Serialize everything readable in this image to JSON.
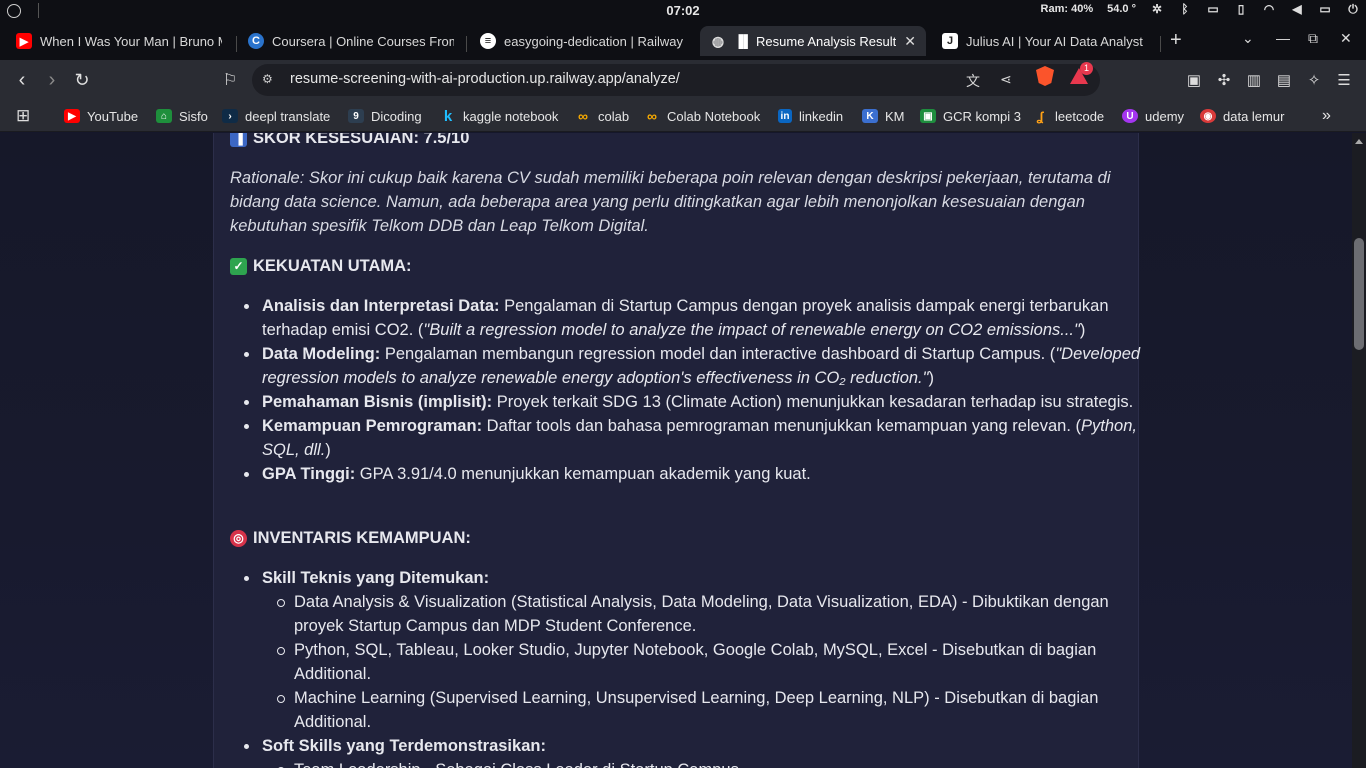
{
  "system": {
    "clock": "07:02",
    "ram": "Ram: 40%",
    "temp": "54.0 °"
  },
  "tabs": [
    {
      "title": "When I Was Your Man | Bruno M",
      "icon": "youtube-icon",
      "color": "#ff0000"
    },
    {
      "title": "Coursera | Online Courses From",
      "icon": "coursera-icon",
      "color": "#2a73cc"
    },
    {
      "title": "easygoing-dedication | Railway",
      "icon": "railway-icon",
      "color": "#ffffff"
    },
    {
      "title": "Resume Analysis Results",
      "icon": "globe-icon",
      "active": true
    },
    {
      "title": "Julius AI | Your AI Data Analyst",
      "icon": "julius-icon",
      "color": "#ffffff"
    }
  ],
  "address": {
    "url": "resume-screening-with-ai-production.up.railway.app/analyze/",
    "badge": "1"
  },
  "bookmarks": [
    {
      "label": "YouTube",
      "icon": "youtube-icon",
      "color": "#ff0000"
    },
    {
      "label": "Sisfo",
      "icon": "sisfo-icon",
      "color": "#1e8f3c"
    },
    {
      "label": "deepl translate",
      "icon": "deepl-icon",
      "color": "#0f2b46"
    },
    {
      "label": "Dicoding",
      "icon": "dicoding-icon",
      "color": "#2d3e50"
    },
    {
      "label": "kaggle notebook",
      "icon": "kaggle-icon",
      "color": "#20beff"
    },
    {
      "label": "colab",
      "icon": "colab-icon",
      "color": "#f9ab00"
    },
    {
      "label": "Colab Notebook",
      "icon": "colab-icon",
      "color": "#f9ab00"
    },
    {
      "label": "linkedin",
      "icon": "linkedin-icon",
      "color": "#0a66c2"
    },
    {
      "label": "KM",
      "icon": "km-icon",
      "color": "#3b6fd0"
    },
    {
      "label": "GCR kompi 3",
      "icon": "classroom-icon",
      "color": "#1e8e3e"
    },
    {
      "label": "leetcode",
      "icon": "leetcode-icon",
      "color": "#ffa116"
    },
    {
      "label": "udemy",
      "icon": "udemy-icon",
      "color": "#a435f0"
    },
    {
      "label": "data lemur",
      "icon": "datalemur-icon",
      "color": "#d93a3a"
    }
  ],
  "analysis": {
    "score_heading": "SKOR KESESUAIAN: 7.5/10",
    "rationale": "Rationale: Skor ini cukup baik karena CV sudah memiliki beberapa poin relevan dengan deskripsi pekerjaan, terutama di bidang data science. Namun, ada beberapa area yang perlu ditingkatkan agar lebih menonjolkan kesesuaian dengan kebutuhan spesifik Telkom DDB dan Leap Telkom Digital.",
    "strengths_heading": "KEKUATAN UTAMA:",
    "strengths": [
      {
        "title": "Analisis dan Interpretasi Data:",
        "text": " Pengalaman di Startup Campus dengan proyek analisis dampak energi terbarukan terhadap emisi CO2. (",
        "quote": "\"Built a regression model to analyze the impact of renewable energy on CO2 emissions...\"",
        "tail": ")"
      },
      {
        "title": "Data Modeling:",
        "text": " Pengalaman membangun regression model dan interactive dashboard di Startup Campus. (",
        "quote": "\"Developed regression models to analyze renewable energy adoption's effectiveness in CO₂ reduction.\"",
        "tail": ")"
      },
      {
        "title": "Pemahaman Bisnis (implisit):",
        "text": " Proyek terkait SDG 13 (Climate Action) menunjukkan kesadaran terhadap isu strategis.",
        "quote": "",
        "tail": ""
      },
      {
        "title": "Kemampuan Pemrograman:",
        "text": " Daftar tools dan bahasa pemrograman menunjukkan kemampuan yang relevan. (",
        "quote": "Python, SQL, dll.",
        "tail": ")"
      },
      {
        "title": "GPA Tinggi:",
        "text": " GPA 3.91/4.0 menunjukkan kemampuan akademik yang kuat.",
        "quote": "",
        "tail": ""
      }
    ],
    "inventory_heading": "INVENTARIS KEMAMPUAN:",
    "inventory": {
      "tech_title": "Skill Teknis yang Ditemukan:",
      "tech_items": [
        "Data Analysis & Visualization (Statistical Analysis, Data Modeling, Data Visualization, EDA) - Dibuktikan dengan proyek Startup Campus dan MDP Student Conference.",
        "Python, SQL, Tableau, Looker Studio, Jupyter Notebook, Google Colab, MySQL, Excel - Disebutkan di bagian Additional.",
        "Machine Learning (Supervised Learning, Unsupervised Learning, Deep Learning, NLP) - Disebutkan di bagian Additional."
      ],
      "soft_title": "Soft Skills yang Terdemonstrasikan:",
      "soft_items": [
        "Team Leadership - Sebagai Class Leader di Startup Campus"
      ]
    }
  }
}
